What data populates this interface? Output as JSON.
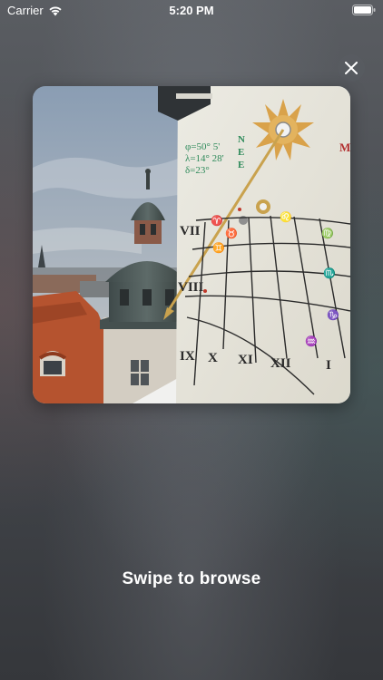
{
  "status_bar": {
    "carrier": "Carrier",
    "time": "5:20 PM",
    "wifi_icon": "wifi-icon",
    "battery_icon": "battery-icon"
  },
  "close_button": {
    "icon": "close-icon"
  },
  "photo": {
    "sundial_inscription": {
      "line1": "φ=50° 5'",
      "line2": "λ=14° 28'",
      "line3": "δ=23°",
      "compass": [
        "N",
        "E",
        "E"
      ]
    },
    "hour_numerals": [
      "VII",
      "VIII",
      "IX",
      "X",
      "XI",
      "XII",
      "I"
    ],
    "colors": {
      "sky": "#8ea2b8",
      "roof": "#b5532f",
      "dial_face": "#e8e6dc",
      "dial_lines": "#2a2a2a",
      "sun_emblem": "#d9a24a"
    }
  },
  "footer": {
    "hint": "Swipe to browse"
  }
}
